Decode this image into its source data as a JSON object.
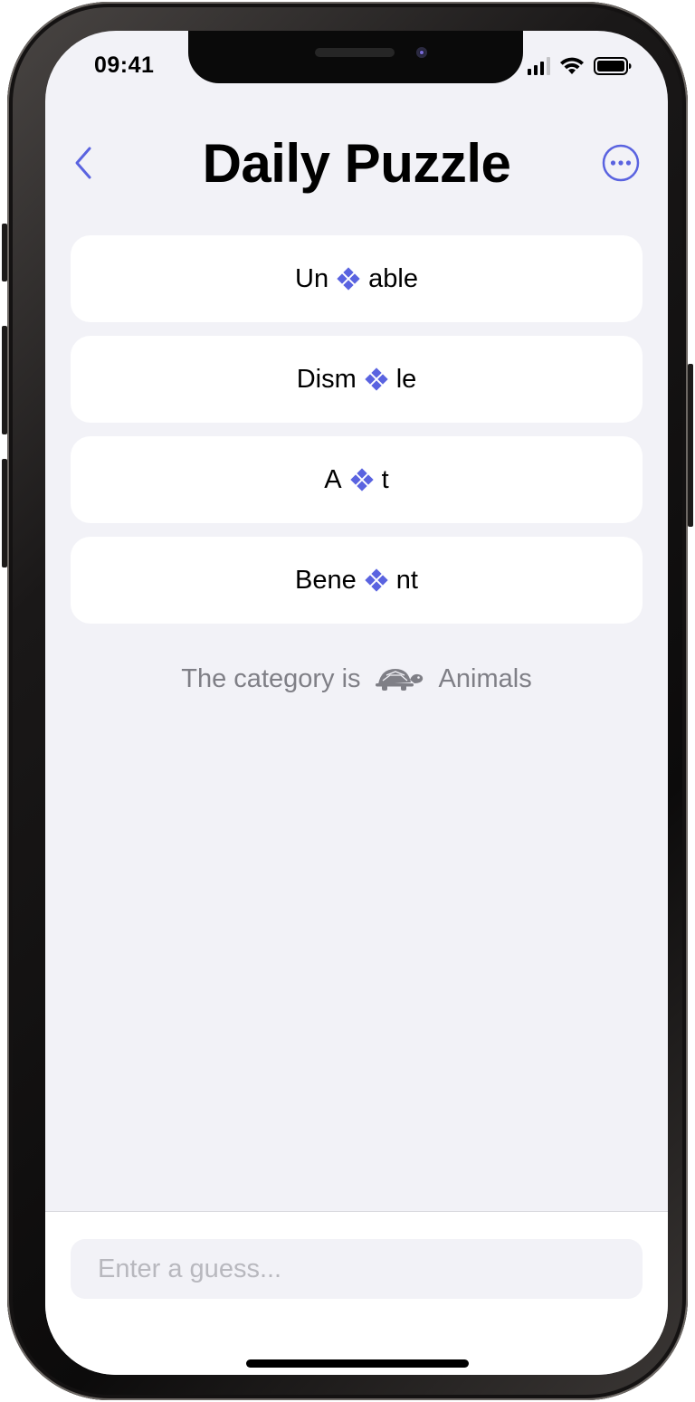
{
  "status_bar": {
    "time": "09:41"
  },
  "header": {
    "title": "Daily Puzzle",
    "back_icon": "chevron-left-icon",
    "more_icon": "ellipsis-circle-icon"
  },
  "clues": [
    {
      "before": "Un",
      "after": "able"
    },
    {
      "before": "Dism",
      "after": "le"
    },
    {
      "before": "A",
      "after": "t"
    },
    {
      "before": "Bene",
      "after": "nt"
    }
  ],
  "category": {
    "prefix": "The category is",
    "icon": "turtle-icon",
    "value": "Animals"
  },
  "guess": {
    "placeholder": "Enter a guess..."
  },
  "colors": {
    "accent": "#5a63e0",
    "background": "#f2f2f7",
    "muted_text": "#7f7f86"
  }
}
